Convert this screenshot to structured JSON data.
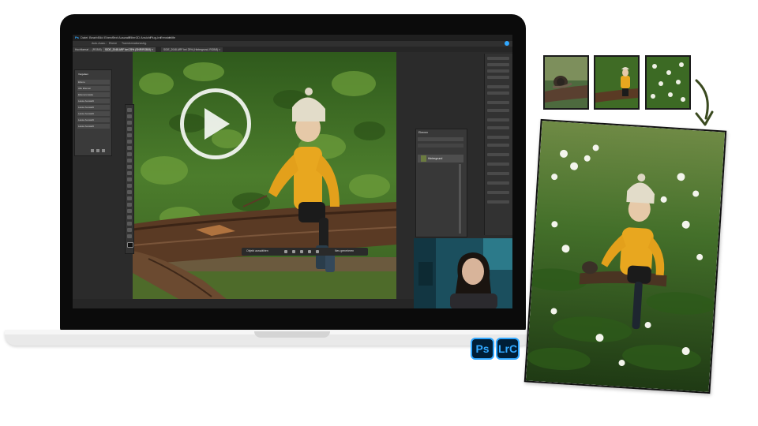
{
  "app": {
    "menu_items": [
      "Ps",
      "Datei",
      "Bearb",
      "Bild",
      "Ebene",
      "Text",
      "Auswahl",
      "Filter",
      "3D",
      "Ansicht",
      "Plug-ins",
      "Fenster",
      "Hilfe"
    ],
    "options_bar": [
      "Auto-Ausw.:",
      "Ebene",
      "Transformationsstrg."
    ],
    "tabs": [
      {
        "label": "Hochformat ... (RGB/8)",
        "active": false
      },
      {
        "label": "SIDE_2048.ARF bei 25% (SNR/RGB/8) ×",
        "active": true
      },
      {
        "label": "SIDE_2048.ARF bei 25% (Hintergrund, RGB/8) ×",
        "active": false
      }
    ]
  },
  "left_panel": {
    "title": "Vorgaben",
    "rows": [
      "Ebene",
      "Alle Ebenen",
      "Ebenenmaske",
      "Lasso Auswahl",
      "Lasso Auswahl",
      "Lasso Auswahl",
      "Lasso Auswahl",
      "Lasso Auswahl"
    ]
  },
  "layers_panel": {
    "title": "Ebenen",
    "layer_name": "Hintergrund"
  },
  "contextual_toolbar": {
    "left_label": "Objekt auswählen",
    "right_label": "Neu generieren"
  },
  "badges": [
    {
      "label": "Ps",
      "color": "#31a8ff"
    },
    {
      "label": "LrC",
      "color": "#31a8ff"
    }
  ],
  "colors": {
    "laptop_bezel": "#0b0b0b",
    "ps_ui": "#2b2b2b",
    "jacket": "#e8a71f",
    "foliage": "#3f6b25",
    "badge_bg": "#001e36"
  },
  "icons": [
    "play-icon",
    "curved-arrow-icon"
  ]
}
